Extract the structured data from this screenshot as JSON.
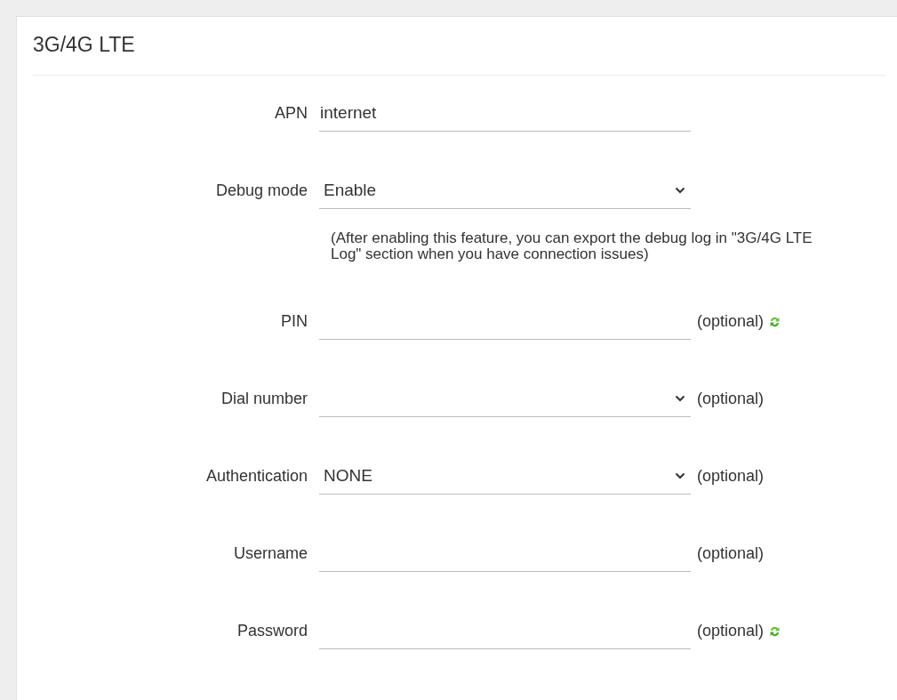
{
  "section": {
    "title": "3G/4G LTE"
  },
  "fields": [
    {
      "label": "APN",
      "kind": "text",
      "value": "internet"
    },
    {
      "label": "Debug mode",
      "kind": "select",
      "value": "Enable",
      "note": "(After enabling this feature, you can export the debug log in \"3G/4G LTE Log\" section when you have connection issues)"
    },
    {
      "label": "PIN",
      "kind": "text",
      "suffix": "(optional)",
      "has_refresh": true
    },
    {
      "label": "Dial number",
      "kind": "select",
      "suffix": "(optional)"
    },
    {
      "label": "Authentication",
      "kind": "select",
      "value": "NONE",
      "suffix": "(optional)"
    },
    {
      "label": "Username",
      "kind": "text",
      "suffix": "(optional)"
    },
    {
      "label": "Password",
      "kind": "text",
      "suffix": "(optional)",
      "has_refresh": true
    }
  ]
}
